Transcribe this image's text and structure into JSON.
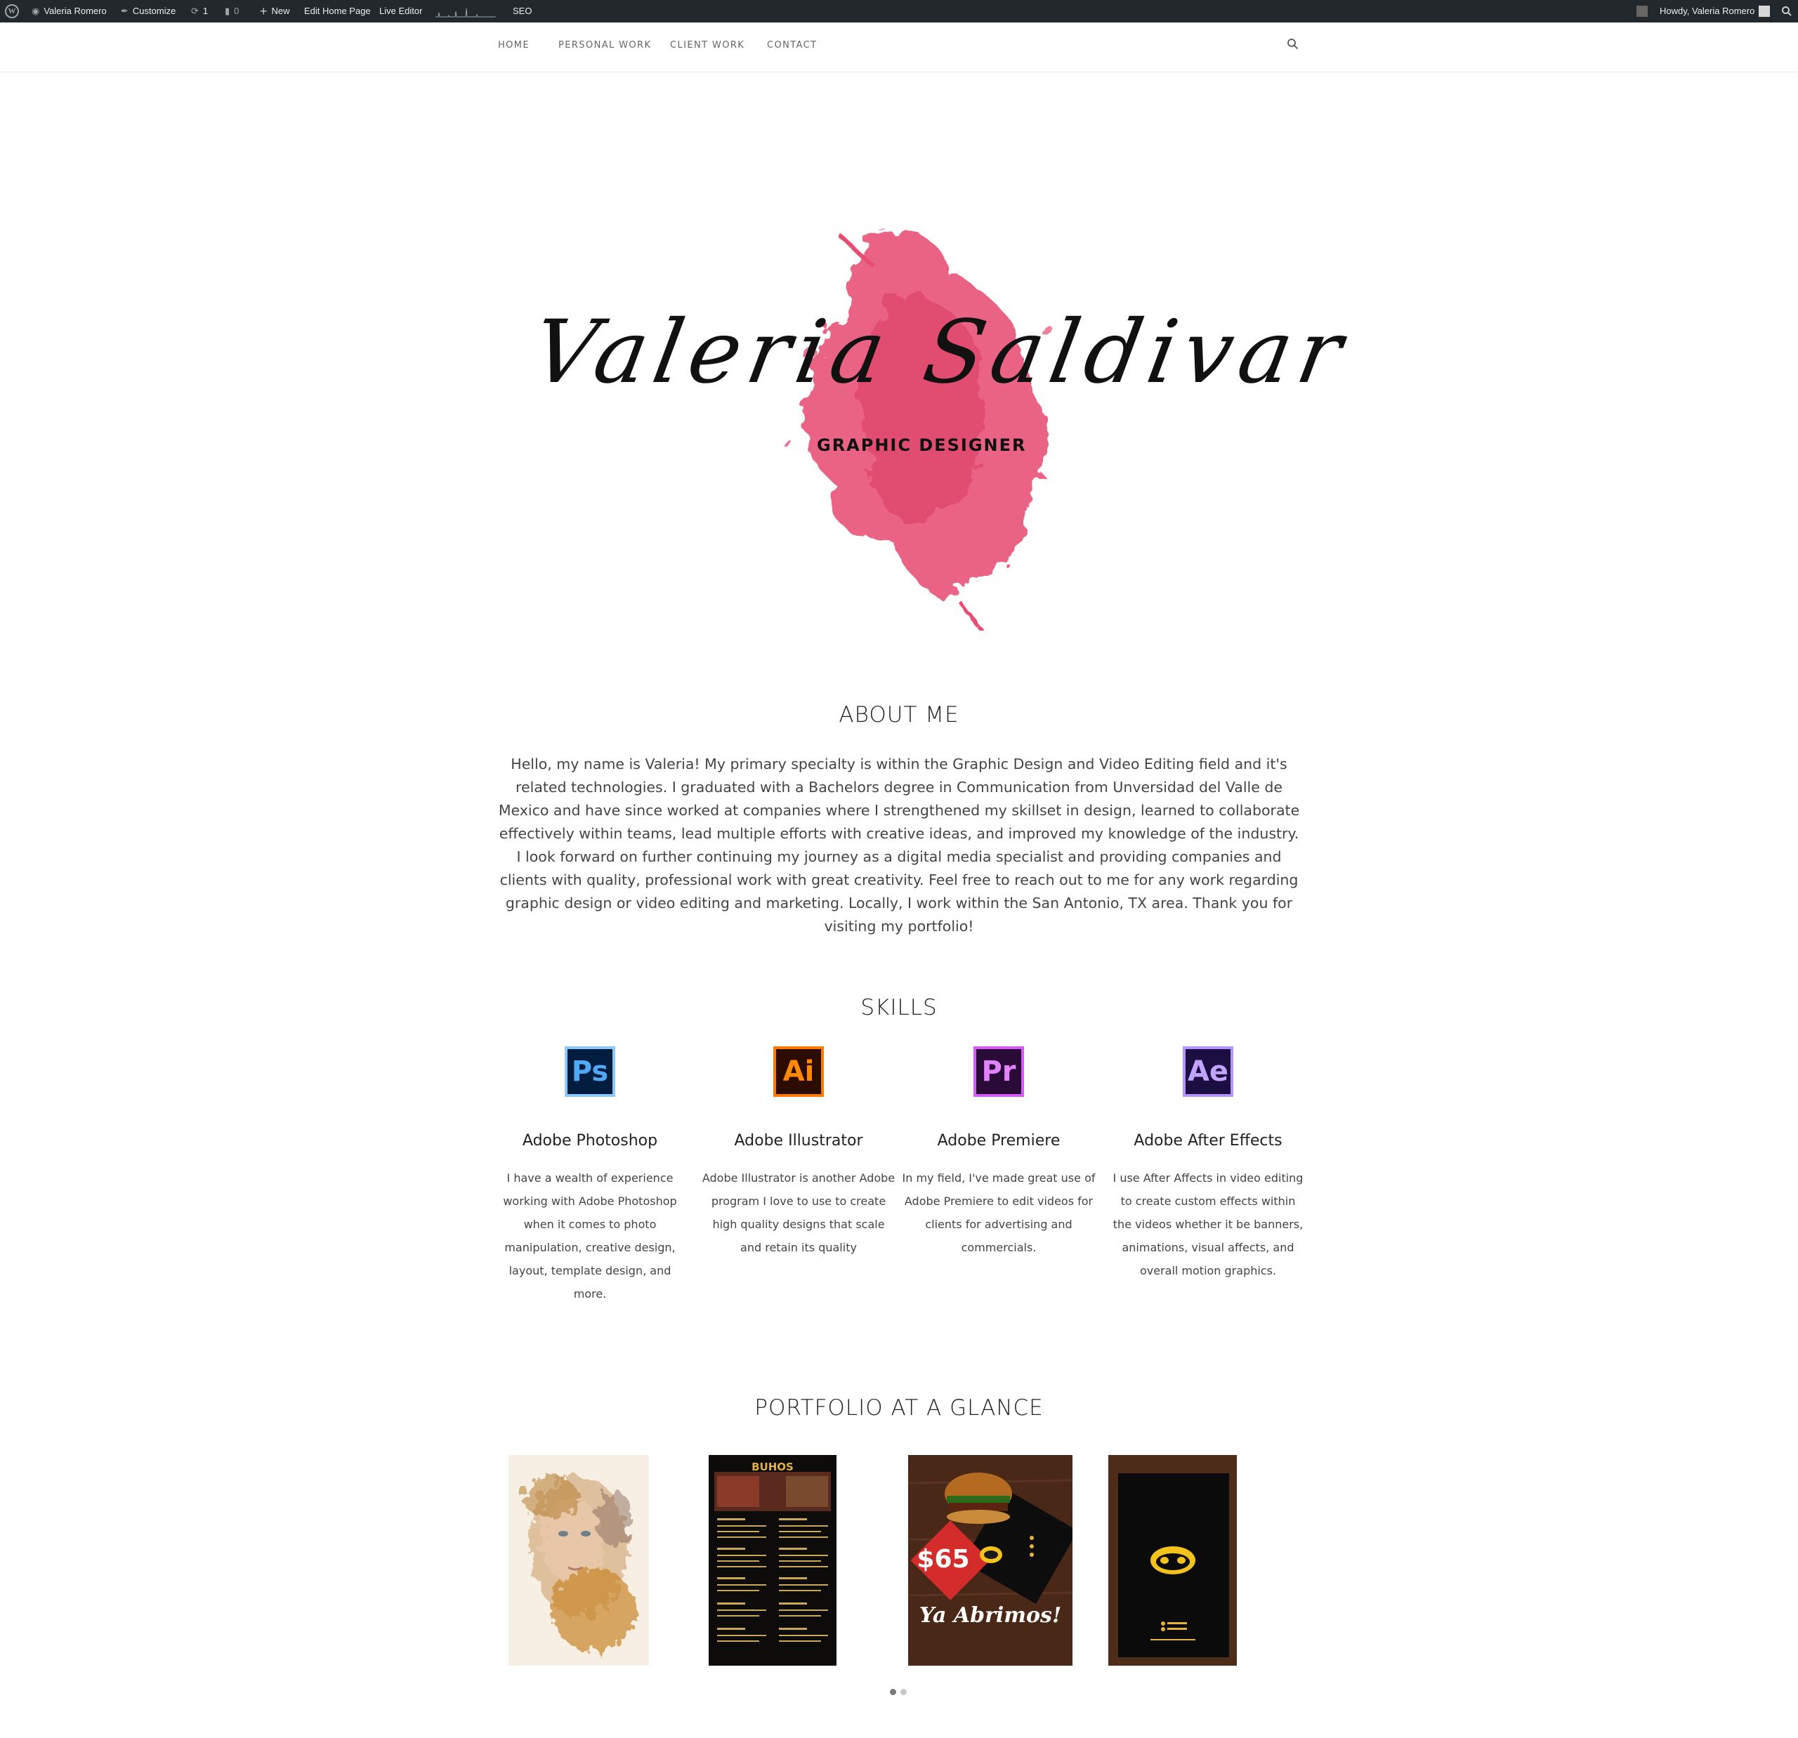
{
  "admin_bar": {
    "site_name": "Valeria Romero",
    "customize": "Customize",
    "updates_count": "1",
    "comments_count": "0",
    "new_label": "New",
    "edit_page": "Edit Home Page",
    "live_editor": "Live Editor",
    "seo": "SEO",
    "greeting": "Howdy, Valeria Romero"
  },
  "nav": {
    "items": [
      "HOME",
      "PERSONAL WORK",
      "CLIENT WORK",
      "CONTACT"
    ],
    "search_icon": "search-icon"
  },
  "hero": {
    "logo_script": "Valeria Saldivar",
    "logo_subtitle": "GRAPHIC DESIGNER",
    "splash_color": "#e84d72"
  },
  "about": {
    "heading": "ABOUT ME",
    "text": "Hello, my name is Valeria! My primary specialty is within the Graphic Design and Video Editing field and it's related technologies. I graduated with a Bachelors degree in Communication from Unversidad del Valle de Mexico and have since worked at companies where I strengthened my skillset in design, learned to collaborate effectively within teams, lead multiple efforts with creative ideas, and improved my knowledge of the industry. I look forward on further continuing my journey as a digital media specialist and providing companies and clients with quality, professional work with great creativity. Feel free to reach out to me for any work regarding graphic design or video editing and marketing. Locally, I work within the San Antonio, TX area. Thank you for visiting my portfolio!"
  },
  "skills": {
    "heading": "SKILLS",
    "items": [
      {
        "abbr": "Ps",
        "name": "Adobe Photoshop",
        "desc": "I have a wealth of experience working with Adobe Photoshop when it comes to photo manipulation, creative design, layout, template design, and more.",
        "bg": "#001c3f",
        "fg": "#4fa9f5",
        "border": "#8fc7f7"
      },
      {
        "abbr": "Ai",
        "name": "Adobe Illustrator",
        "desc": "Adobe Illustrator is another Adobe program I love to use to create high quality designs that scale and retain its quality",
        "bg": "#2d0c00",
        "fg": "#ff8a00",
        "border": "#ff7b00"
      },
      {
        "abbr": "Pr",
        "name": "Adobe Premiere",
        "desc": "In my field, I've made great use of Adobe Premiere to edit videos for clients for advertising and commercials.",
        "bg": "#2a0a36",
        "fg": "#e383ff",
        "border": "#d55cf7"
      },
      {
        "abbr": "Ae",
        "name": "Adobe After Effects",
        "desc": "I use After Affects in video editing to create custom effects within the videos whether it be banners, animations, visual affects, and overall motion graphics.",
        "bg": "#1b0e40",
        "fg": "#c2a4ff",
        "border": "#b795ff"
      }
    ]
  },
  "portfolio": {
    "heading": "PORTFOLIO AT A GLANCE",
    "flyer_price": "$65",
    "flyer_title": "Ya Abrimos!",
    "menu_title": "BUHOS",
    "slider_dots": 2
  }
}
